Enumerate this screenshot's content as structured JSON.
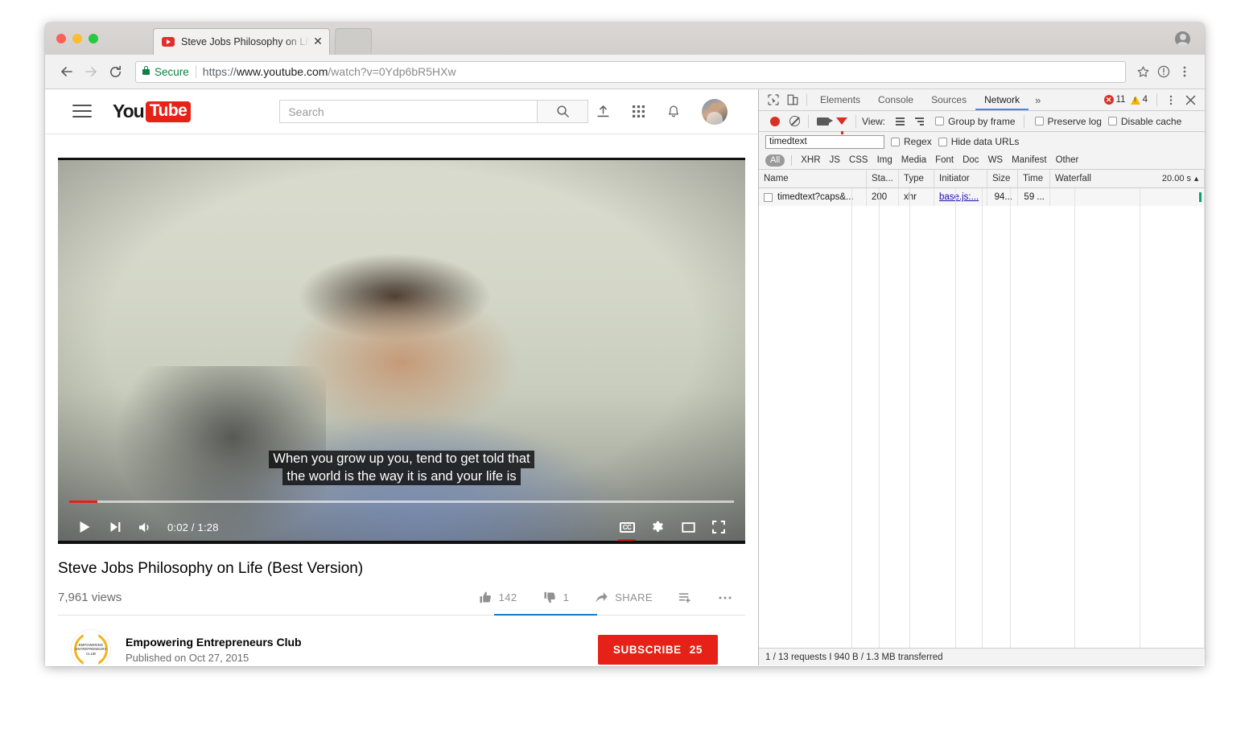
{
  "browser": {
    "tab": {
      "title": "Steve Jobs Philosophy on Life",
      "close_label": "✕"
    },
    "omnibox": {
      "secure_label": "Secure",
      "url_scheme": "https://",
      "url_host": "www.youtube.com",
      "url_path": "/watch?v=0Ydp6bR5HXw"
    }
  },
  "youtube": {
    "search": {
      "placeholder": "Search"
    },
    "video": {
      "caption_line1": "When you grow up you, tend to get told that",
      "caption_line2": "the world is the way it is and your life is",
      "time_display": "0:02 / 1:28",
      "cc_label": "CC"
    },
    "title": "Steve Jobs Philosophy on Life (Best Version)",
    "views": "7,961 views",
    "likes": "142",
    "dislikes": "1",
    "share_label": "SHARE",
    "channel": {
      "name": "Empowering Entrepreneurs Club",
      "published": "Published on Oct 27, 2015",
      "avatar_line1": "EMPOWERING",
      "avatar_line2": "ENTREPRENEURS",
      "avatar_line3": "CLUB"
    },
    "subscribe": {
      "label": "SUBSCRIBE",
      "count": "25"
    }
  },
  "devtools": {
    "tabs": [
      {
        "label": "Elements",
        "active": false
      },
      {
        "label": "Console",
        "active": false
      },
      {
        "label": "Sources",
        "active": false
      },
      {
        "label": "Network",
        "active": true
      }
    ],
    "more_label": "»",
    "errors": "11",
    "warnings": "4",
    "toolbar": {
      "view_label": "View:",
      "group_by_frame": "Group by frame",
      "preserve_log": "Preserve log",
      "disable_cache": "Disable cache"
    },
    "filter": {
      "value": "timedtext",
      "regex_label": "Regex",
      "hide_data_urls_label": "Hide data URLs"
    },
    "types": [
      "All",
      "XHR",
      "JS",
      "CSS",
      "Img",
      "Media",
      "Font",
      "Doc",
      "WS",
      "Manifest",
      "Other"
    ],
    "grid": {
      "headers": [
        "Name",
        "Sta...",
        "Type",
        "Initiator",
        "Size",
        "Time",
        "Waterfall"
      ],
      "timeline_label": "20.00 s",
      "rows": [
        {
          "name": "timedtext?caps&...",
          "status": "200",
          "type": "xhr",
          "initiator": "base.js:...",
          "size": "94...",
          "time": "59 ..."
        }
      ]
    },
    "status": "1 / 13 requests I 940 B / 1.3 MB transferred"
  },
  "colors": {
    "accent_red": "#e62117",
    "devtools_blue": "#4285f4",
    "secure_green": "#0a8043",
    "like_underline": "#167ac6"
  }
}
